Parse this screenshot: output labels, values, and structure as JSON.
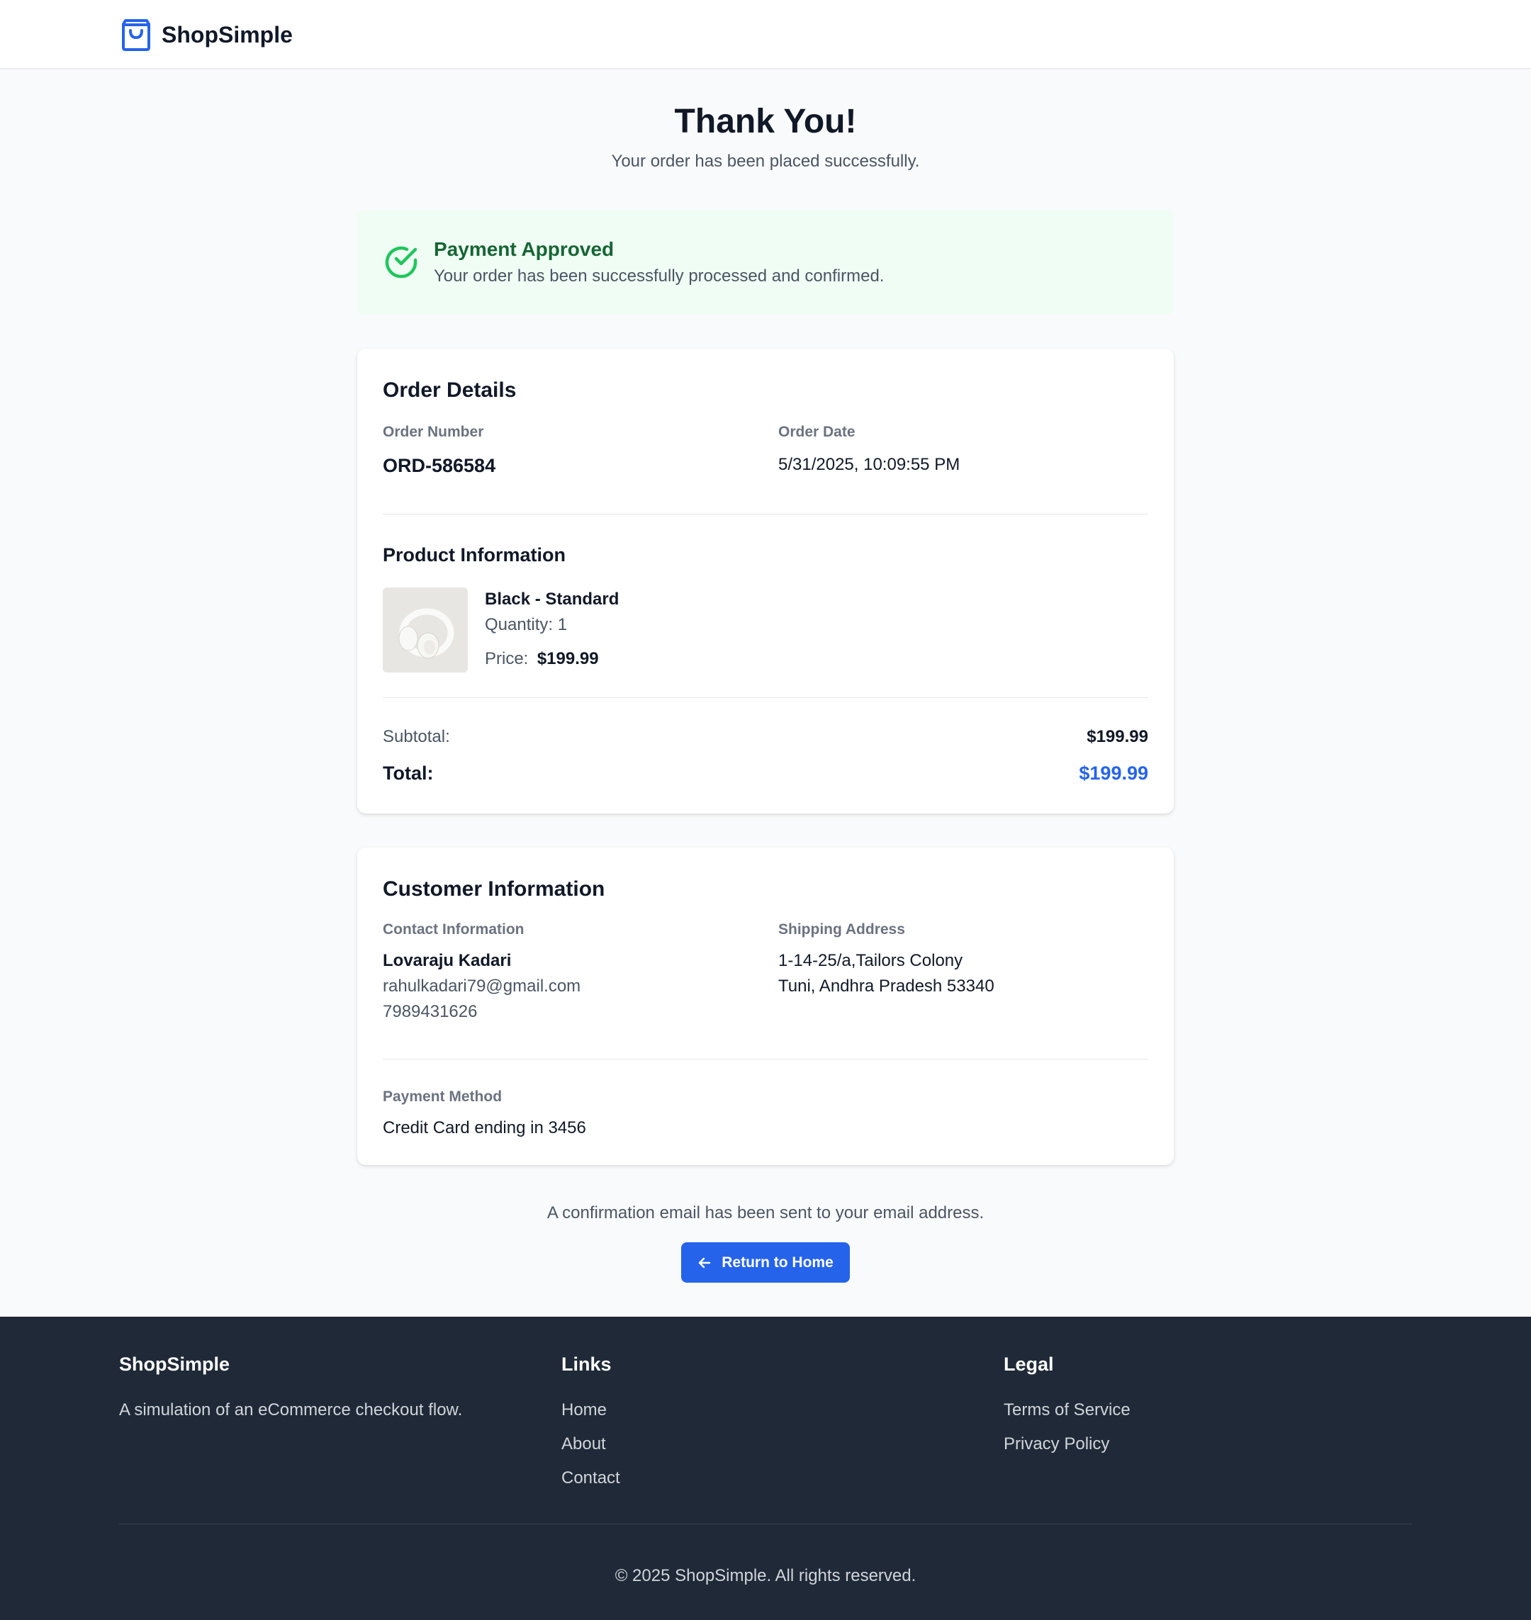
{
  "header": {
    "brand": "ShopSimple",
    "brand_icon": "shopping-bag-icon"
  },
  "hero": {
    "title": "Thank You!",
    "subtitle": "Your order has been placed successfully."
  },
  "payment_status": {
    "icon": "check-circle-icon",
    "title": "Payment Approved",
    "message": "Your order has been successfully processed and confirmed.",
    "color": "#22c55e"
  },
  "order_details": {
    "title": "Order Details",
    "order_number_label": "Order Number",
    "order_number": "ORD-586584",
    "order_date_label": "Order Date",
    "order_date": "5/31/2025, 10:09:55 PM",
    "product_section_title": "Product Information",
    "product": {
      "image_icon": "headphones-image",
      "name": "Black - Standard",
      "quantity": "Quantity: 1",
      "price_label": "Price:",
      "price": "$199.99"
    },
    "subtotal_label": "Subtotal:",
    "subtotal": "$199.99",
    "total_label": "Total:",
    "total": "$199.99"
  },
  "customer": {
    "title": "Customer Information",
    "contact_label": "Contact Information",
    "name": "Lovaraju Kadari",
    "email": "rahulkadari79@gmail.com",
    "phone": "7989431626",
    "shipping_label": "Shipping Address",
    "address_line1": "1-14-25/a,Tailors Colony",
    "address_line2": "Tuni, Andhra Pradesh 53340",
    "payment_label": "Payment Method",
    "payment_method": "Credit Card ending in 3456"
  },
  "confirmation": {
    "note": "A confirmation email has been sent to your email address.",
    "button_label": "Return to Home",
    "button_icon": "arrow-left-icon"
  },
  "footer": {
    "brand": "ShopSimple",
    "tagline": "A simulation of an eCommerce checkout flow.",
    "links_title": "Links",
    "links": [
      "Home",
      "About",
      "Contact"
    ],
    "legal_title": "Legal",
    "legal": [
      "Terms of Service",
      "Privacy Policy"
    ],
    "copyright": "© 2025 ShopSimple. All rights reserved."
  },
  "colors": {
    "accent": "#2563eb",
    "success": "#22c55e",
    "success_bg": "#f0fdf4",
    "footer_bg": "#1f2937"
  }
}
